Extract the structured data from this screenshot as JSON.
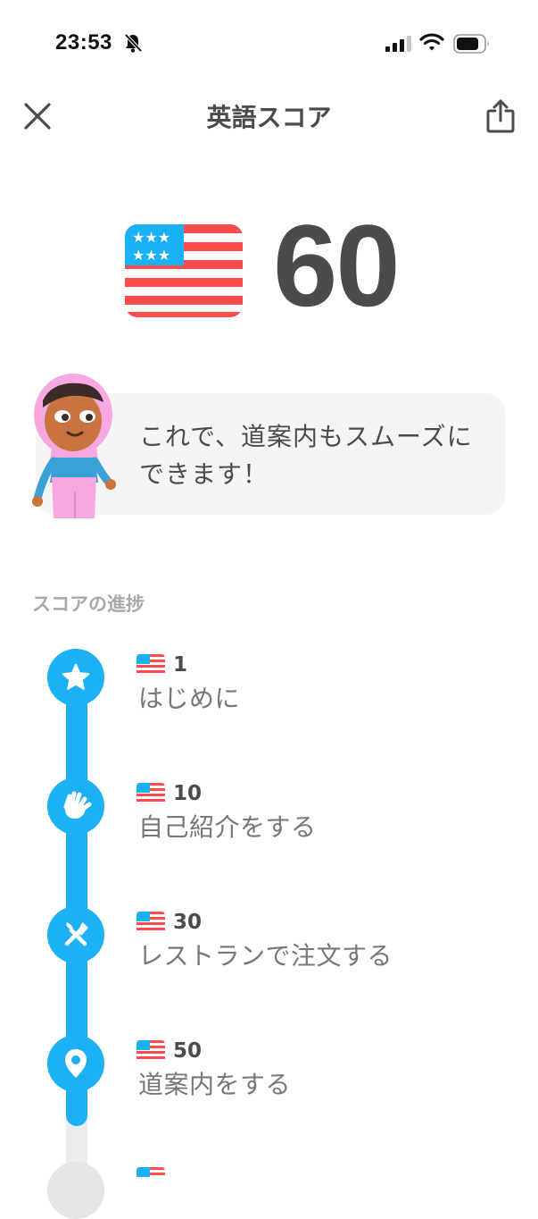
{
  "status_bar": {
    "time": "23:53"
  },
  "header": {
    "title": "英語スコア"
  },
  "score": {
    "value": "60"
  },
  "message": {
    "line1": "これで、道案内もスムーズに",
    "line2": "できます！"
  },
  "progress": {
    "section_title": "スコアの進捗",
    "milestones": [
      {
        "score": "1",
        "label": "はじめに",
        "icon": "star-icon"
      },
      {
        "score": "10",
        "label": "自己紹介をする",
        "icon": "waving-hand-icon"
      },
      {
        "score": "30",
        "label": "レストランで注文する",
        "icon": "fork-knife-icon"
      },
      {
        "score": "50",
        "label": "道案内をする",
        "icon": "map-pin-icon"
      }
    ]
  },
  "colors": {
    "accent": "#1cb0f6",
    "text": "#4b4b4b",
    "muted": "#a8a8a8",
    "flag_red": "#ff4b4b",
    "flag_blue": "#1cb0f6"
  }
}
